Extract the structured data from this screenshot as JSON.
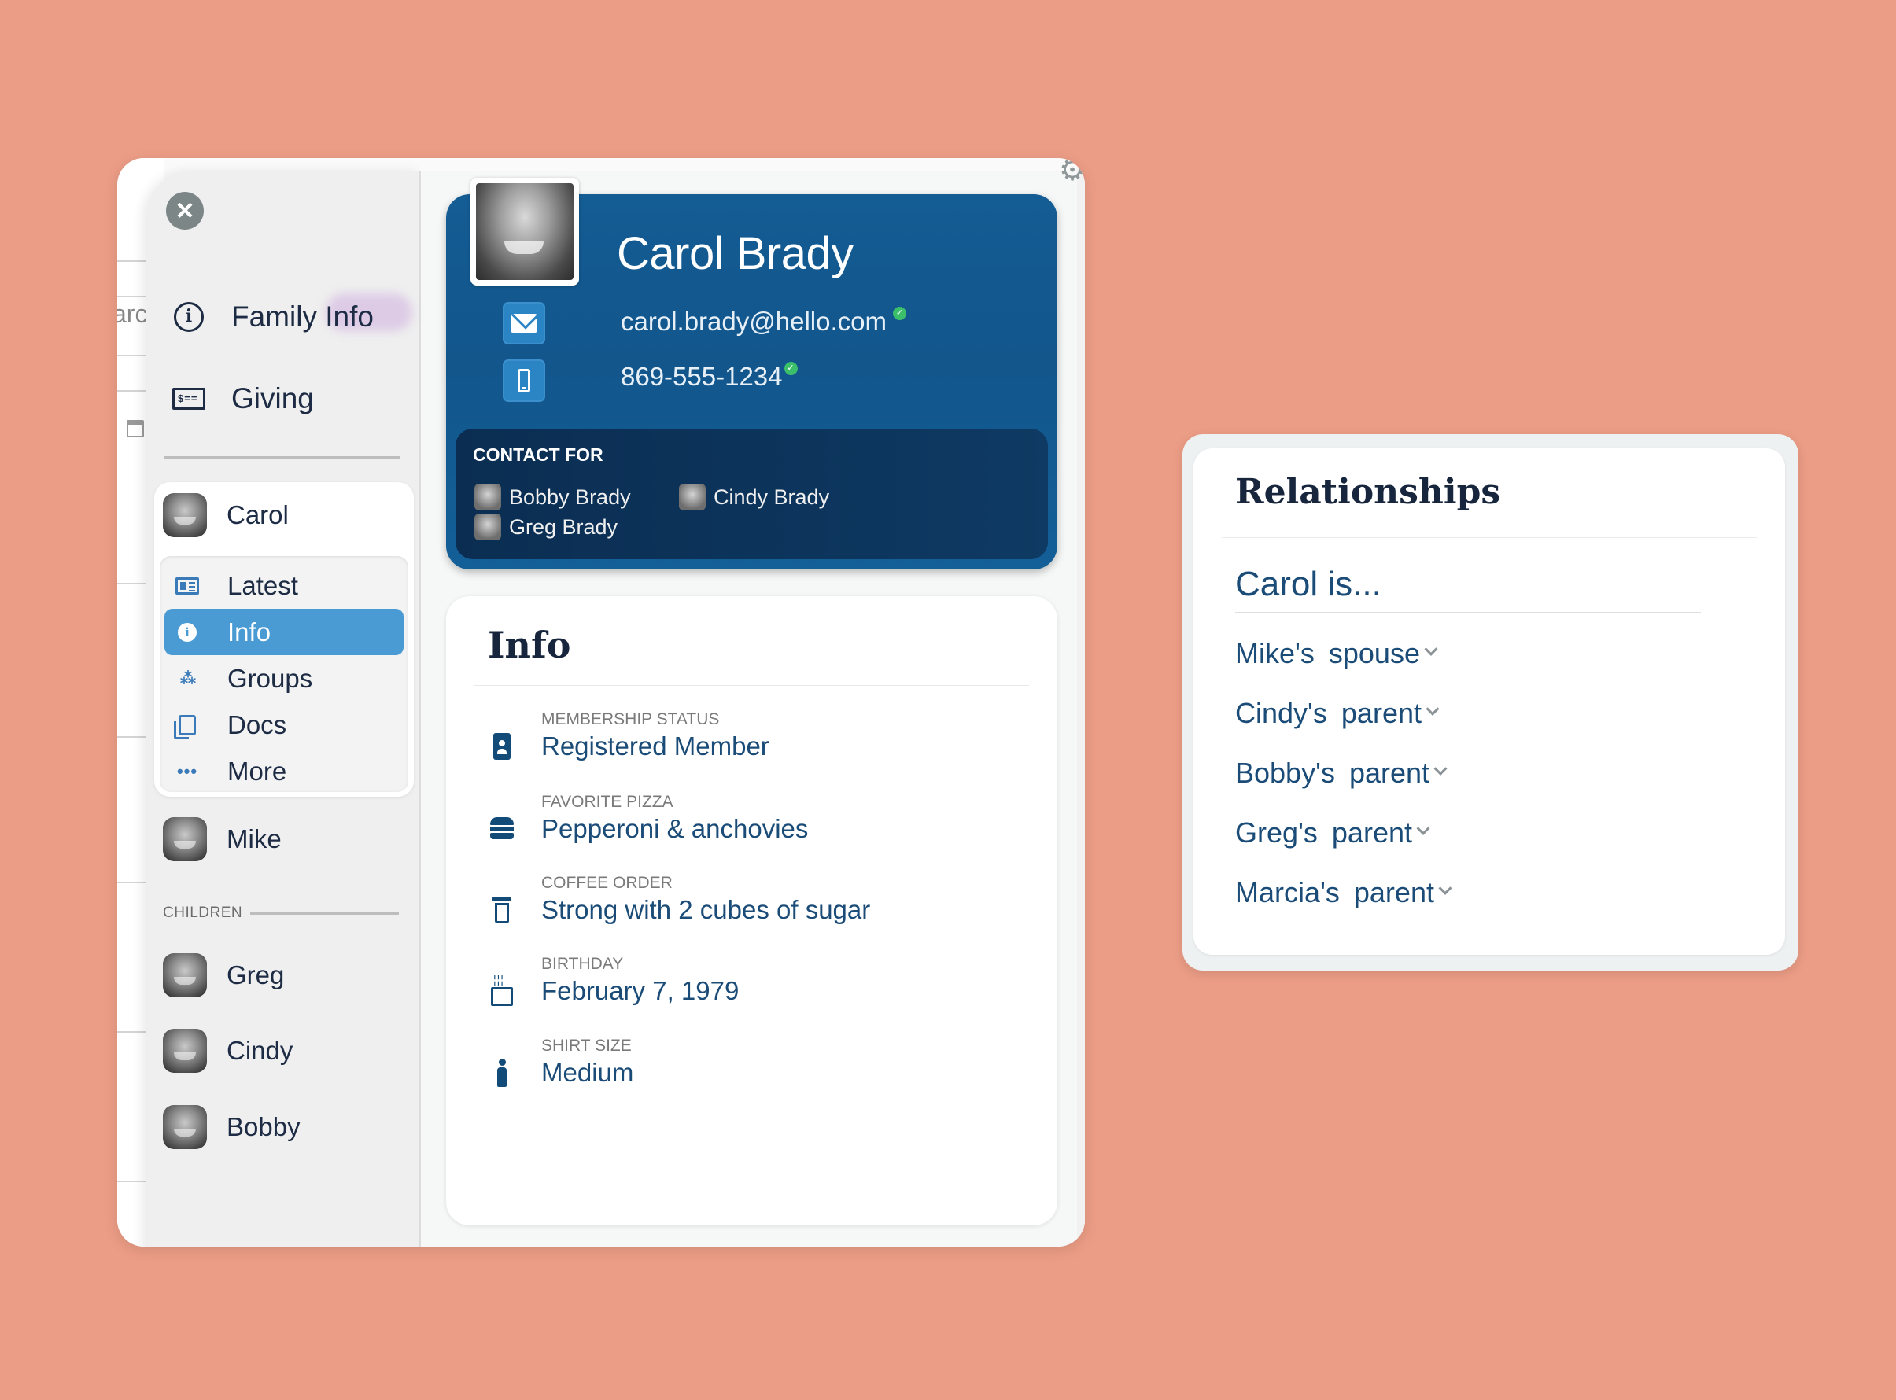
{
  "colors": {
    "background": "#ec9d86",
    "brand_dark": "#134b78",
    "header_blue": "#145c94",
    "active_nav": "#4a9ad4",
    "crown_gold": "#e8b95a",
    "crown_gray": "#b3b3b3",
    "verified_green": "#3cbf6b"
  },
  "background_app": {
    "partial_text": "arc"
  },
  "sidebar": {
    "close_icon": "close-circle-icon",
    "nav": [
      {
        "label": "Family Info",
        "icon": "info-circle-icon"
      },
      {
        "label": "Giving",
        "icon": "check-dollar-icon"
      }
    ],
    "members": [
      {
        "name": "Carol",
        "role": "head",
        "crown": "gold"
      },
      {
        "name": "Mike",
        "role": "head",
        "crown": "gray"
      }
    ],
    "sub_nav": [
      {
        "label": "Latest",
        "icon": "newspaper-icon",
        "active": false
      },
      {
        "label": "Info",
        "icon": "info-icon",
        "active": true
      },
      {
        "label": "Groups",
        "icon": "groups-icon",
        "active": false
      },
      {
        "label": "Docs",
        "icon": "docs-icon",
        "active": false
      },
      {
        "label": "More",
        "icon": "more-icon",
        "active": false
      }
    ],
    "children_heading": "CHILDREN",
    "children": [
      {
        "name": "Greg"
      },
      {
        "name": "Cindy"
      },
      {
        "name": "Bobby"
      }
    ]
  },
  "profile": {
    "name": "Carol Brady",
    "email": "carol.brady@hello.com",
    "email_verified": true,
    "phone": "869-555-1234",
    "phone_verified": true,
    "contact_for_title": "CONTACT FOR",
    "contact_for": [
      {
        "name": "Bobby Brady"
      },
      {
        "name": "Cindy Brady"
      },
      {
        "name": "Greg Brady"
      }
    ]
  },
  "info": {
    "title": "Info",
    "fields": [
      {
        "label": "MEMBERSHIP STATUS",
        "value": "Registered Member",
        "icon": "id-badge-icon"
      },
      {
        "label": "FAVORITE PIZZA",
        "value": "Pepperoni & anchovies",
        "icon": "burger-icon"
      },
      {
        "label": "COFFEE ORDER",
        "value": "Strong with 2 cubes of sugar",
        "icon": "coffee-cup-icon"
      },
      {
        "label": "BIRTHDAY",
        "value": "February 7, 1979",
        "icon": "birthday-cake-icon"
      },
      {
        "label": "SHIRT SIZE",
        "value": "Medium",
        "icon": "person-icon"
      }
    ]
  },
  "relationships": {
    "title": "Relationships",
    "subtitle": "Carol is...",
    "items": [
      {
        "label": "Mike's spouse"
      },
      {
        "label": "Cindy's parent"
      },
      {
        "label": "Bobby's parent"
      },
      {
        "label": "Greg's parent"
      },
      {
        "label": "Marcia's parent"
      }
    ]
  }
}
